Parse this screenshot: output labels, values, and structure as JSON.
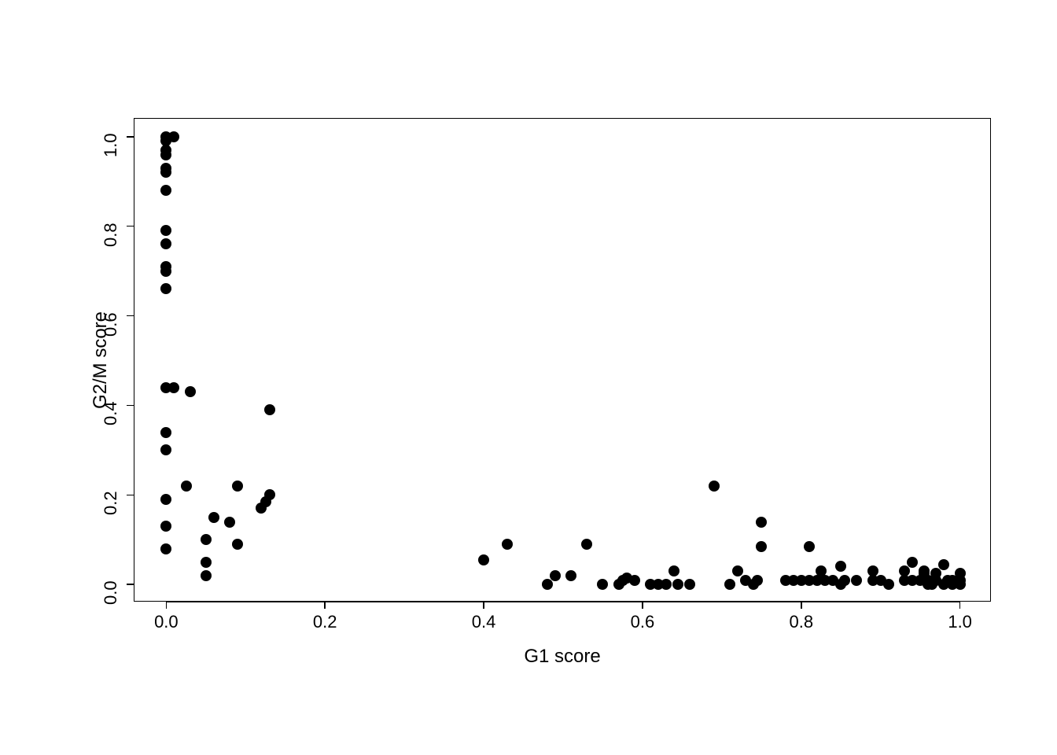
{
  "chart_data": {
    "type": "scatter",
    "xlabel": "G1 score",
    "ylabel": "G2/M score",
    "xlim": [
      0.0,
      1.0
    ],
    "ylim": [
      0.0,
      1.0
    ],
    "x_ticks": [
      0.0,
      0.2,
      0.4,
      0.6,
      0.8,
      1.0
    ],
    "y_ticks": [
      0.0,
      0.2,
      0.4,
      0.6,
      0.8,
      1.0
    ],
    "x_tick_labels": [
      "0.0",
      "0.2",
      "0.4",
      "0.6",
      "0.8",
      "1.0"
    ],
    "y_tick_labels": [
      "0.0",
      "0.2",
      "0.4",
      "0.6",
      "0.8",
      "1.0"
    ],
    "points": [
      {
        "x": 0.0,
        "y": 0.08
      },
      {
        "x": 0.0,
        "y": 0.13
      },
      {
        "x": 0.0,
        "y": 0.19
      },
      {
        "x": 0.0,
        "y": 0.3
      },
      {
        "x": 0.0,
        "y": 0.34
      },
      {
        "x": 0.0,
        "y": 0.44
      },
      {
        "x": 0.01,
        "y": 0.44
      },
      {
        "x": 0.0,
        "y": 0.66
      },
      {
        "x": 0.0,
        "y": 0.7
      },
      {
        "x": 0.0,
        "y": 0.71
      },
      {
        "x": 0.0,
        "y": 0.76
      },
      {
        "x": 0.0,
        "y": 0.79
      },
      {
        "x": 0.0,
        "y": 0.88
      },
      {
        "x": 0.0,
        "y": 0.92
      },
      {
        "x": 0.0,
        "y": 0.93
      },
      {
        "x": 0.0,
        "y": 0.96
      },
      {
        "x": 0.0,
        "y": 0.97
      },
      {
        "x": 0.0,
        "y": 0.99
      },
      {
        "x": 0.0,
        "y": 1.0
      },
      {
        "x": 0.01,
        "y": 1.0
      },
      {
        "x": 0.025,
        "y": 0.22
      },
      {
        "x": 0.03,
        "y": 0.43
      },
      {
        "x": 0.05,
        "y": 0.02
      },
      {
        "x": 0.05,
        "y": 0.05
      },
      {
        "x": 0.05,
        "y": 0.1
      },
      {
        "x": 0.06,
        "y": 0.15
      },
      {
        "x": 0.08,
        "y": 0.14
      },
      {
        "x": 0.09,
        "y": 0.09
      },
      {
        "x": 0.09,
        "y": 0.22
      },
      {
        "x": 0.12,
        "y": 0.17
      },
      {
        "x": 0.125,
        "y": 0.185
      },
      {
        "x": 0.13,
        "y": 0.2
      },
      {
        "x": 0.13,
        "y": 0.39
      },
      {
        "x": 0.4,
        "y": 0.055
      },
      {
        "x": 0.43,
        "y": 0.09
      },
      {
        "x": 0.48,
        "y": 0.0
      },
      {
        "x": 0.49,
        "y": 0.02
      },
      {
        "x": 0.51,
        "y": 0.02
      },
      {
        "x": 0.53,
        "y": 0.09
      },
      {
        "x": 0.55,
        "y": 0.0
      },
      {
        "x": 0.57,
        "y": 0.0
      },
      {
        "x": 0.575,
        "y": 0.01
      },
      {
        "x": 0.58,
        "y": 0.015
      },
      {
        "x": 0.59,
        "y": 0.01
      },
      {
        "x": 0.61,
        "y": 0.0
      },
      {
        "x": 0.62,
        "y": 0.0
      },
      {
        "x": 0.63,
        "y": 0.0
      },
      {
        "x": 0.64,
        "y": 0.03
      },
      {
        "x": 0.645,
        "y": 0.0
      },
      {
        "x": 0.66,
        "y": 0.0
      },
      {
        "x": 0.69,
        "y": 0.22
      },
      {
        "x": 0.71,
        "y": 0.0
      },
      {
        "x": 0.72,
        "y": 0.03
      },
      {
        "x": 0.73,
        "y": 0.01
      },
      {
        "x": 0.74,
        "y": 0.0
      },
      {
        "x": 0.745,
        "y": 0.01
      },
      {
        "x": 0.75,
        "y": 0.14
      },
      {
        "x": 0.75,
        "y": 0.085
      },
      {
        "x": 0.78,
        "y": 0.01
      },
      {
        "x": 0.79,
        "y": 0.01
      },
      {
        "x": 0.8,
        "y": 0.01
      },
      {
        "x": 0.81,
        "y": 0.085
      },
      {
        "x": 0.81,
        "y": 0.01
      },
      {
        "x": 0.82,
        "y": 0.01
      },
      {
        "x": 0.825,
        "y": 0.03
      },
      {
        "x": 0.83,
        "y": 0.01
      },
      {
        "x": 0.84,
        "y": 0.01
      },
      {
        "x": 0.85,
        "y": 0.0
      },
      {
        "x": 0.855,
        "y": 0.01
      },
      {
        "x": 0.85,
        "y": 0.04
      },
      {
        "x": 0.87,
        "y": 0.01
      },
      {
        "x": 0.89,
        "y": 0.01
      },
      {
        "x": 0.89,
        "y": 0.03
      },
      {
        "x": 0.9,
        "y": 0.01
      },
      {
        "x": 0.91,
        "y": 0.0
      },
      {
        "x": 0.93,
        "y": 0.01
      },
      {
        "x": 0.93,
        "y": 0.03
      },
      {
        "x": 0.94,
        "y": 0.05
      },
      {
        "x": 0.94,
        "y": 0.01
      },
      {
        "x": 0.95,
        "y": 0.01
      },
      {
        "x": 0.955,
        "y": 0.03
      },
      {
        "x": 0.955,
        "y": 0.025
      },
      {
        "x": 0.96,
        "y": 0.0
      },
      {
        "x": 0.96,
        "y": 0.01
      },
      {
        "x": 0.965,
        "y": 0.0
      },
      {
        "x": 0.97,
        "y": 0.025
      },
      {
        "x": 0.98,
        "y": 0.045
      },
      {
        "x": 0.97,
        "y": 0.01
      },
      {
        "x": 0.98,
        "y": 0.0
      },
      {
        "x": 0.985,
        "y": 0.01
      },
      {
        "x": 0.99,
        "y": 0.0
      },
      {
        "x": 0.99,
        "y": 0.01
      },
      {
        "x": 1.0,
        "y": 0.025
      },
      {
        "x": 1.0,
        "y": 0.0
      },
      {
        "x": 1.0,
        "y": 0.01
      }
    ]
  }
}
